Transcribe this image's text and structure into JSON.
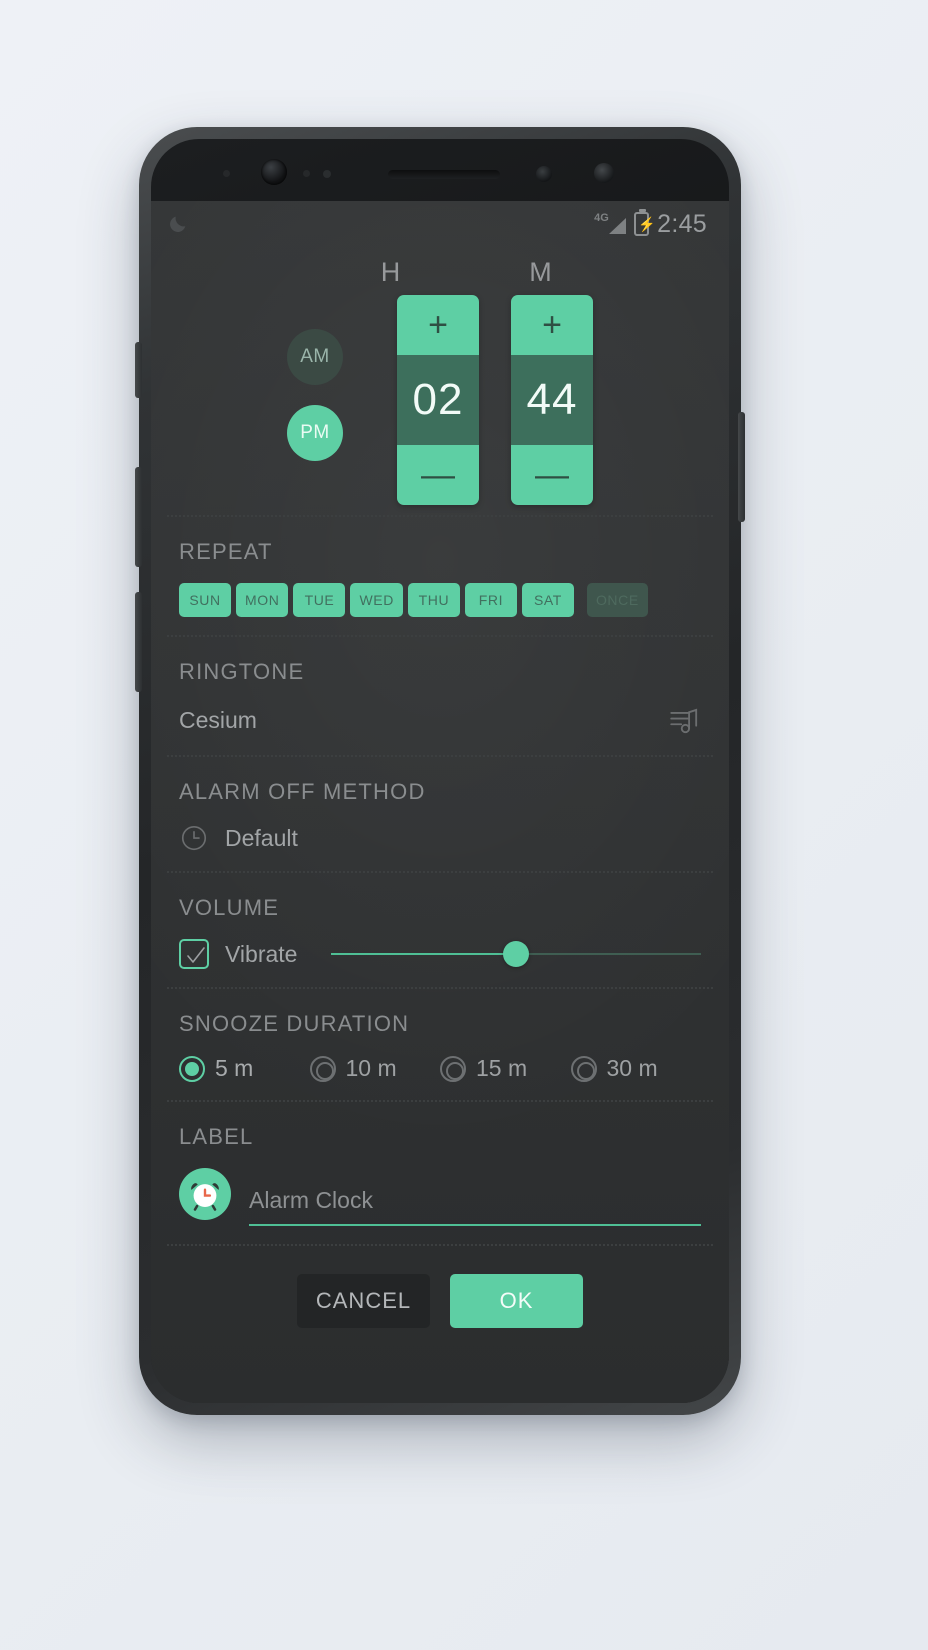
{
  "statusbar": {
    "network": "4G",
    "time": "2:45",
    "moon_icon": "moon-icon",
    "signal_icon": "signal-bars-icon",
    "battery_icon": "battery-charging-icon"
  },
  "time_picker": {
    "hour_label": "H",
    "minute_label": "M",
    "hour_value": "02",
    "minute_value": "44",
    "increment_glyph": "+",
    "decrement_glyph": "—",
    "am_label": "AM",
    "pm_label": "PM",
    "selected_meridiem": "PM"
  },
  "repeat": {
    "title": "REPEAT",
    "days": [
      {
        "label": "SUN",
        "active": true
      },
      {
        "label": "MON",
        "active": true
      },
      {
        "label": "TUE",
        "active": true
      },
      {
        "label": "WED",
        "active": true
      },
      {
        "label": "THU",
        "active": true
      },
      {
        "label": "FRI",
        "active": true
      },
      {
        "label": "SAT",
        "active": true
      }
    ],
    "once": {
      "label": "ONCE",
      "active": false
    }
  },
  "ringtone": {
    "title": "RINGTONE",
    "value": "Cesium",
    "picker_icon": "playlist-music-icon"
  },
  "alarm_off_method": {
    "title": "ALARM OFF METHOD",
    "value": "Default",
    "icon": "clock-icon"
  },
  "volume": {
    "title": "VOLUME",
    "vibrate_label": "Vibrate",
    "vibrate_checked": true,
    "level_percent": 50
  },
  "snooze": {
    "title": "SNOOZE DURATION",
    "options": [
      {
        "label": "5 m",
        "selected": true
      },
      {
        "label": "10 m",
        "selected": false
      },
      {
        "label": "15 m",
        "selected": false
      },
      {
        "label": "30 m",
        "selected": false
      }
    ]
  },
  "label": {
    "title": "LABEL",
    "value": "Alarm Clock",
    "avatar_icon": "alarm-clock-icon"
  },
  "actions": {
    "cancel_label": "CANCEL",
    "ok_label": "OK"
  },
  "colors": {
    "accent": "#5ecfa4",
    "accent_dark": "#3d6f5c",
    "screen_bg": "#2f3132",
    "text_muted": "#8a8d8f"
  }
}
